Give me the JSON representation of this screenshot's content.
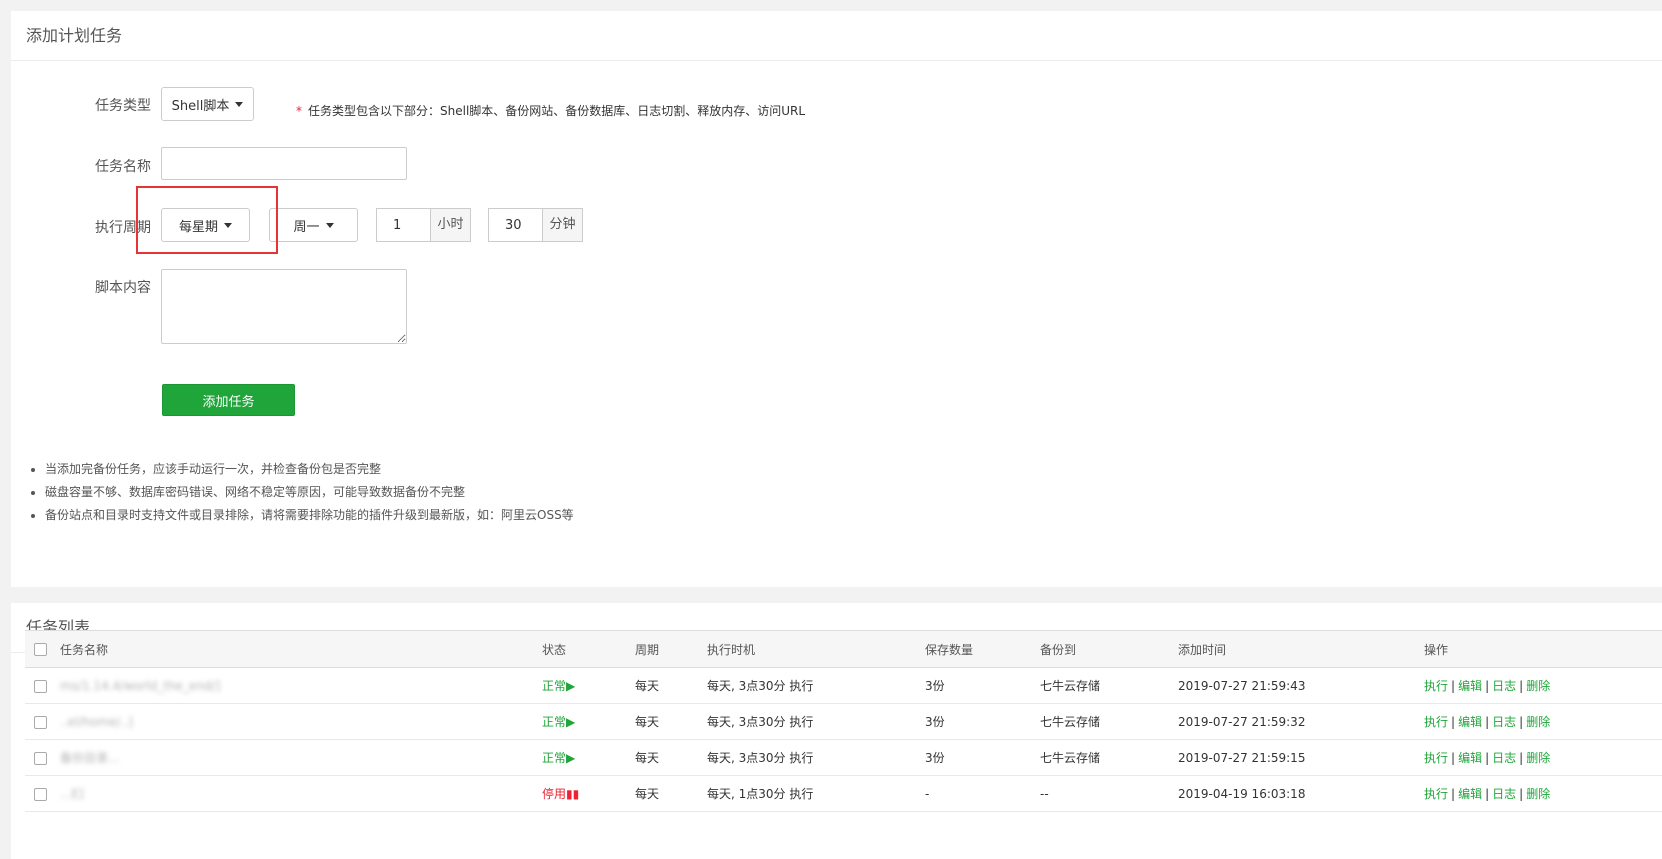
{
  "add_panel": {
    "title": "添加计划任务",
    "task_type_label": "任务类型",
    "task_type_value": "Shell脚本",
    "task_type_hint_star": "*",
    "task_type_hint": "任务类型包含以下部分：Shell脚本、备份网站、备份数据库、日志切割、释放内存、访问URL",
    "task_name_label": "任务名称",
    "task_name_value": "",
    "cycle_label": "执行周期",
    "cycle_value": "每星期",
    "weekday_value": "周一",
    "hour_value": "1",
    "hour_unit": "小时",
    "minute_value": "30",
    "minute_unit": "分钟",
    "script_label": "脚本内容",
    "script_value": "",
    "submit_label": "添加任务",
    "notes": [
      "当添加完备份任务，应该手动运行一次，并检查备份包是否完整",
      "磁盘容量不够、数据库密码错误、网络不稳定等原因，可能导致数据备份不完整",
      "备份站点和目录时支持文件或目录排除，请将需要排除功能的插件升级到最新版，如：阿里云OSS等"
    ]
  },
  "list_panel": {
    "title": "任务列表",
    "columns": [
      "任务名称",
      "状态",
      "周期",
      "执行时机",
      "保存数量",
      "备份到",
      "添加时间",
      "操作"
    ],
    "rows": [
      {
        "name": "ms/1.14.4/world_the_end/]",
        "status": "正常▶",
        "cycle": "每天",
        "timing": "每天, 3点30分 执行",
        "keep": "3份",
        "backup_to": "七牛云存储",
        "added": "2019-07-27 21:59:43"
      },
      {
        "name": "..el/home/..]",
        "status": "正常▶",
        "cycle": "每天",
        "timing": "每天, 3点30分 执行",
        "keep": "3份",
        "backup_to": "七牛云存储",
        "added": "2019-07-27 21:59:32"
      },
      {
        "name": "备份目录...",
        "status": "正常▶",
        "cycle": "每天",
        "timing": "每天, 3点30分 执行",
        "keep": "3份",
        "backup_to": "七牛云存储",
        "added": "2019-07-27 21:59:15"
      },
      {
        "name": "...E]",
        "status": "停用▮▮",
        "cycle": "每天",
        "timing": "每天, 1点30分 执行",
        "keep": "-",
        "backup_to": "--",
        "added": "2019-04-19 16:03:18"
      }
    ],
    "ops": [
      "执行",
      "编辑",
      "日志",
      "删除"
    ],
    "ops_sep": "|"
  },
  "colors": {
    "accent": "#20a53a",
    "danger": "#e23333",
    "highlight_box": "#e63333"
  }
}
